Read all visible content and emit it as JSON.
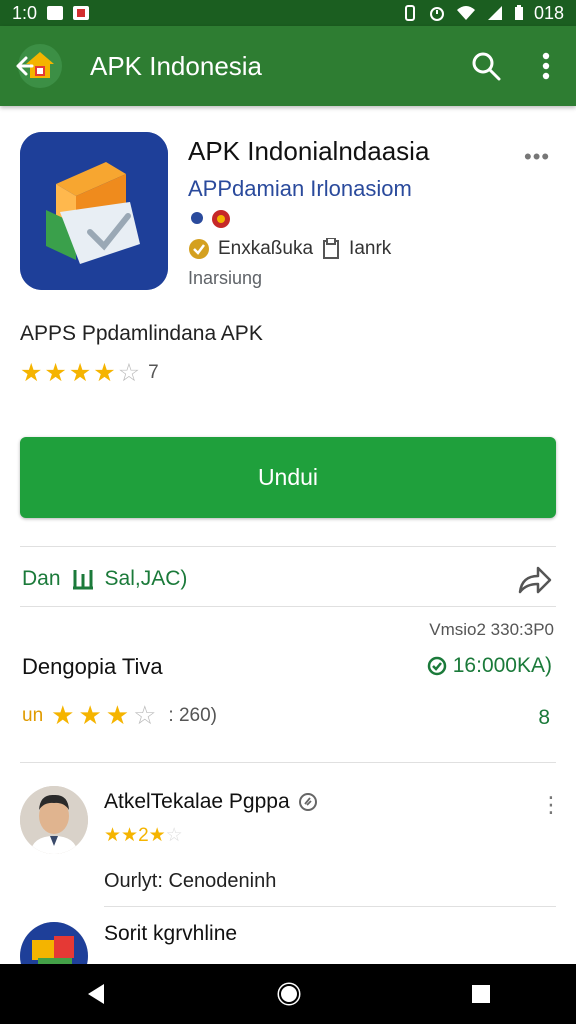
{
  "status_bar": {
    "time": "1:0",
    "battery_level": "018"
  },
  "app_bar": {
    "title": "APK Indonesia",
    "icons": [
      "back-arrow-icon",
      "search-icon",
      "more-vert-icon"
    ]
  },
  "app": {
    "name": "APK Indonialndaasia",
    "developer": "APPdamian Irlonasiom",
    "verified_label": "Enxkaßuka",
    "category_label": "Ianrk",
    "subtitle": "Inarsiung",
    "more_label": "•••",
    "tagline": "APPS Ppdamlindana APK",
    "rating_stars": 4,
    "rating_count": "7"
  },
  "install_button": {
    "label": "Undui"
  },
  "info_row": {
    "prefix": "Dan",
    "text": "Sal,JAC)"
  },
  "version": "Vmsio2 330:3P0",
  "stats": {
    "title": "Dengopia Tiva",
    "size": "16:000KA)",
    "rating_prefix": "un",
    "rating_stars": 3,
    "rating_count": ": 260)",
    "number": "8"
  },
  "reviews": [
    {
      "name": "AtkelTekalae Pgppa",
      "rating_text": "★★2★",
      "text": "Ourlyt: Cenodeninh"
    },
    {
      "name": "Sorit kgrvhline",
      "rating_text": "",
      "text": ""
    }
  ],
  "colors": {
    "primary": "#2e7d32",
    "status": "#1b5e20",
    "accent": "#1fa03c",
    "star": "#f5b400"
  }
}
